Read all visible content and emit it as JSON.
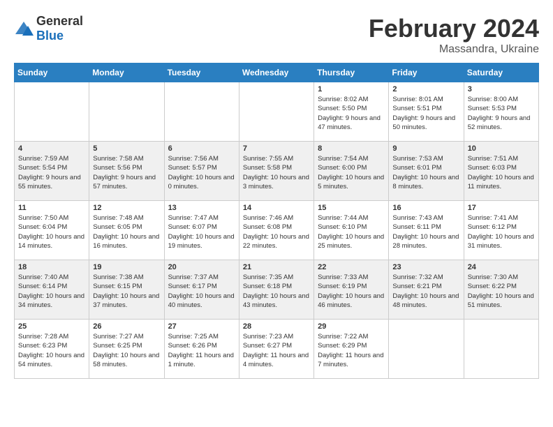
{
  "logo": {
    "general": "General",
    "blue": "Blue"
  },
  "title": "February 2024",
  "subtitle": "Massandra, Ukraine",
  "days_of_week": [
    "Sunday",
    "Monday",
    "Tuesday",
    "Wednesday",
    "Thursday",
    "Friday",
    "Saturday"
  ],
  "weeks": [
    [
      {
        "day": "",
        "info": ""
      },
      {
        "day": "",
        "info": ""
      },
      {
        "day": "",
        "info": ""
      },
      {
        "day": "",
        "info": ""
      },
      {
        "day": "1",
        "info": "Sunrise: 8:02 AM\nSunset: 5:50 PM\nDaylight: 9 hours and 47 minutes."
      },
      {
        "day": "2",
        "info": "Sunrise: 8:01 AM\nSunset: 5:51 PM\nDaylight: 9 hours and 50 minutes."
      },
      {
        "day": "3",
        "info": "Sunrise: 8:00 AM\nSunset: 5:53 PM\nDaylight: 9 hours and 52 minutes."
      }
    ],
    [
      {
        "day": "4",
        "info": "Sunrise: 7:59 AM\nSunset: 5:54 PM\nDaylight: 9 hours and 55 minutes."
      },
      {
        "day": "5",
        "info": "Sunrise: 7:58 AM\nSunset: 5:56 PM\nDaylight: 9 hours and 57 minutes."
      },
      {
        "day": "6",
        "info": "Sunrise: 7:56 AM\nSunset: 5:57 PM\nDaylight: 10 hours and 0 minutes."
      },
      {
        "day": "7",
        "info": "Sunrise: 7:55 AM\nSunset: 5:58 PM\nDaylight: 10 hours and 3 minutes."
      },
      {
        "day": "8",
        "info": "Sunrise: 7:54 AM\nSunset: 6:00 PM\nDaylight: 10 hours and 5 minutes."
      },
      {
        "day": "9",
        "info": "Sunrise: 7:53 AM\nSunset: 6:01 PM\nDaylight: 10 hours and 8 minutes."
      },
      {
        "day": "10",
        "info": "Sunrise: 7:51 AM\nSunset: 6:03 PM\nDaylight: 10 hours and 11 minutes."
      }
    ],
    [
      {
        "day": "11",
        "info": "Sunrise: 7:50 AM\nSunset: 6:04 PM\nDaylight: 10 hours and 14 minutes."
      },
      {
        "day": "12",
        "info": "Sunrise: 7:48 AM\nSunset: 6:05 PM\nDaylight: 10 hours and 16 minutes."
      },
      {
        "day": "13",
        "info": "Sunrise: 7:47 AM\nSunset: 6:07 PM\nDaylight: 10 hours and 19 minutes."
      },
      {
        "day": "14",
        "info": "Sunrise: 7:46 AM\nSunset: 6:08 PM\nDaylight: 10 hours and 22 minutes."
      },
      {
        "day": "15",
        "info": "Sunrise: 7:44 AM\nSunset: 6:10 PM\nDaylight: 10 hours and 25 minutes."
      },
      {
        "day": "16",
        "info": "Sunrise: 7:43 AM\nSunset: 6:11 PM\nDaylight: 10 hours and 28 minutes."
      },
      {
        "day": "17",
        "info": "Sunrise: 7:41 AM\nSunset: 6:12 PM\nDaylight: 10 hours and 31 minutes."
      }
    ],
    [
      {
        "day": "18",
        "info": "Sunrise: 7:40 AM\nSunset: 6:14 PM\nDaylight: 10 hours and 34 minutes."
      },
      {
        "day": "19",
        "info": "Sunrise: 7:38 AM\nSunset: 6:15 PM\nDaylight: 10 hours and 37 minutes."
      },
      {
        "day": "20",
        "info": "Sunrise: 7:37 AM\nSunset: 6:17 PM\nDaylight: 10 hours and 40 minutes."
      },
      {
        "day": "21",
        "info": "Sunrise: 7:35 AM\nSunset: 6:18 PM\nDaylight: 10 hours and 43 minutes."
      },
      {
        "day": "22",
        "info": "Sunrise: 7:33 AM\nSunset: 6:19 PM\nDaylight: 10 hours and 46 minutes."
      },
      {
        "day": "23",
        "info": "Sunrise: 7:32 AM\nSunset: 6:21 PM\nDaylight: 10 hours and 48 minutes."
      },
      {
        "day": "24",
        "info": "Sunrise: 7:30 AM\nSunset: 6:22 PM\nDaylight: 10 hours and 51 minutes."
      }
    ],
    [
      {
        "day": "25",
        "info": "Sunrise: 7:28 AM\nSunset: 6:23 PM\nDaylight: 10 hours and 54 minutes."
      },
      {
        "day": "26",
        "info": "Sunrise: 7:27 AM\nSunset: 6:25 PM\nDaylight: 10 hours and 58 minutes."
      },
      {
        "day": "27",
        "info": "Sunrise: 7:25 AM\nSunset: 6:26 PM\nDaylight: 11 hours and 1 minute."
      },
      {
        "day": "28",
        "info": "Sunrise: 7:23 AM\nSunset: 6:27 PM\nDaylight: 11 hours and 4 minutes."
      },
      {
        "day": "29",
        "info": "Sunrise: 7:22 AM\nSunset: 6:29 PM\nDaylight: 11 hours and 7 minutes."
      },
      {
        "day": "",
        "info": ""
      },
      {
        "day": "",
        "info": ""
      }
    ]
  ]
}
